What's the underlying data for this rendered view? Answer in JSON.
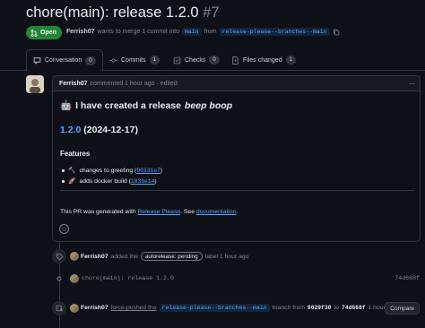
{
  "header": {
    "title": "chore(main): release 1.2.0",
    "number": "#7",
    "state": "Open",
    "author": "Ferrish07",
    "merge_text": "wants to merge 1 commit into",
    "base_branch": "main",
    "from_text": "from",
    "head_branch": "release-please--branches--main"
  },
  "tabs": [
    {
      "label": "Conversation",
      "count": "0"
    },
    {
      "label": "Commits",
      "count": "1"
    },
    {
      "label": "Checks",
      "count": "0"
    },
    {
      "label": "Files changed",
      "count": "1"
    }
  ],
  "comment": {
    "author": "Ferrish07",
    "meta": "commented 1 hour ago · edited",
    "heading_emoji": "🤖",
    "heading_text": "I have created a release",
    "heading_italic": "beep boop",
    "version_link": "1.2.0",
    "version_date": "(2024-12-17)",
    "section": "Features",
    "items": [
      {
        "emoji": "🔨",
        "text": "changes to greeting (",
        "sha": "00331e7",
        "close": ")"
      },
      {
        "emoji": "🚀",
        "text": "adds docker build (",
        "sha": "1833e14",
        "close": ")"
      }
    ],
    "note_prefix": "This PR was generated with",
    "note_link1": "Release Please",
    "note_mid": ". See",
    "note_link2": "documentation",
    "note_end": "."
  },
  "timeline": {
    "label_event": {
      "author": "Ferrish07",
      "action": "added the",
      "label": "autorelease: pending",
      "suffix": "label 1 hour ago"
    },
    "commit_event": {
      "message": "chore(main): release 1.2.0",
      "sha": "74d668f"
    },
    "push_event": {
      "author": "Ferrish07",
      "action": "force-pushed the",
      "branch": "release-please--branches--main",
      "mid": "branch from",
      "from_sha": "9629f30",
      "to": "to",
      "to_sha": "74d668f",
      "time": "1 hour ago",
      "button": "Compare"
    }
  },
  "colors": {
    "accent": "#58a6ff",
    "open_green": "#238636",
    "background": "#0d1117"
  }
}
